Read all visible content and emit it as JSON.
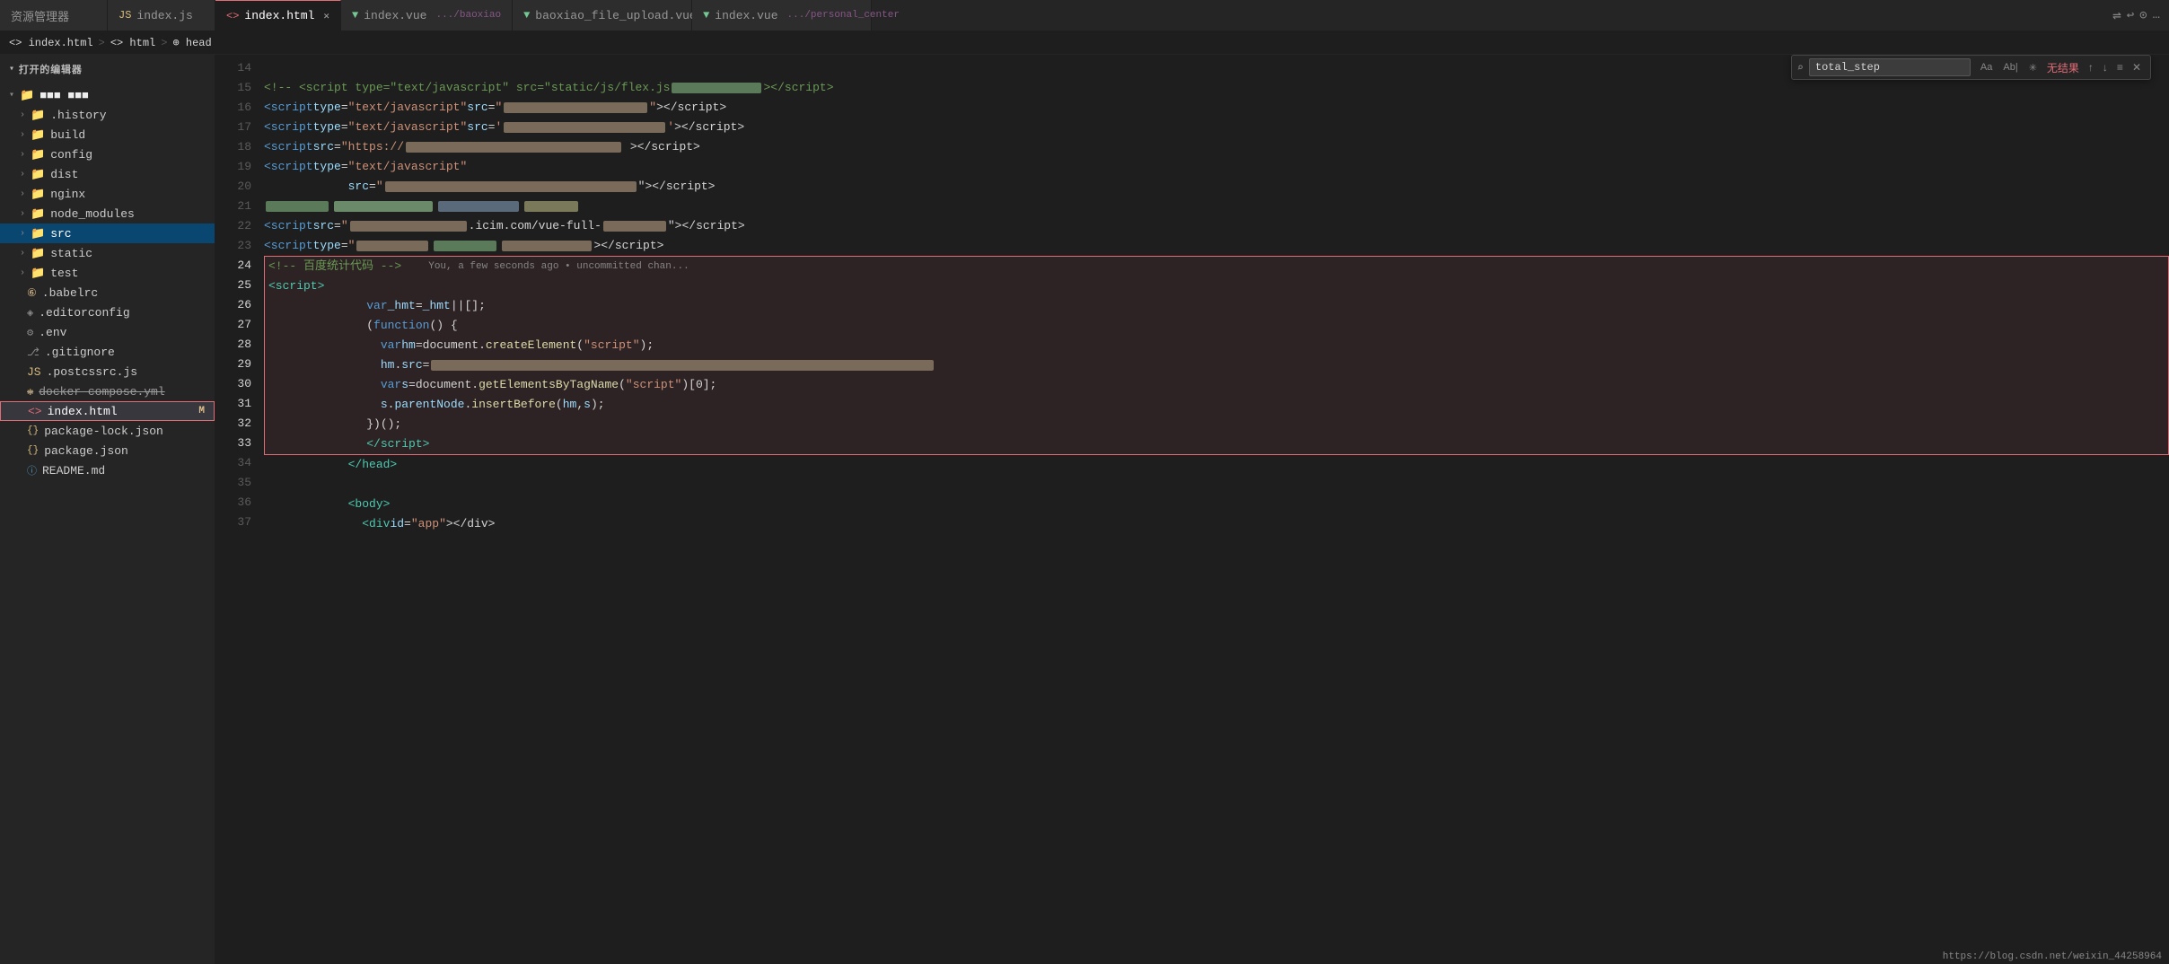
{
  "tabBar": {
    "tabs": [
      {
        "id": "resource-manager",
        "label": "资源管理器",
        "type": "resource",
        "active": false,
        "closable": false
      },
      {
        "id": "index-js",
        "label": "index.js",
        "type": "js",
        "active": false,
        "closable": false
      },
      {
        "id": "index-html",
        "label": "index.html",
        "type": "html",
        "active": true,
        "closable": true
      },
      {
        "id": "index-vue-baoxiao",
        "label": "index.vue",
        "subLabel": ".../baoxiao",
        "type": "vue",
        "active": false,
        "closable": false
      },
      {
        "id": "baoxiao-file-upload",
        "label": "baoxiao_file_upload.vue",
        "type": "vue",
        "active": false,
        "closable": false
      },
      {
        "id": "index-vue-personal",
        "label": "index.vue",
        "subLabel": ".../personal_center",
        "type": "vue",
        "active": false,
        "closable": false
      }
    ]
  },
  "breadcrumb": {
    "items": [
      "<> index.html",
      "> <> html",
      "> ⊕ head"
    ]
  },
  "sidebar": {
    "explorerTitle": "打开的编辑器",
    "projectName": "■■■ ■■■",
    "items": [
      {
        "id": "history",
        "label": ".history",
        "type": "folder",
        "indent": 1
      },
      {
        "id": "build",
        "label": "build",
        "type": "folder",
        "indent": 1
      },
      {
        "id": "config",
        "label": "config",
        "type": "folder",
        "indent": 1
      },
      {
        "id": "dist",
        "label": "dist",
        "type": "folder",
        "indent": 1
      },
      {
        "id": "nginx",
        "label": "nginx",
        "type": "folder",
        "indent": 1
      },
      {
        "id": "node_modules",
        "label": "node_modules",
        "type": "folder",
        "indent": 1
      },
      {
        "id": "src",
        "label": "src",
        "type": "folder",
        "indent": 1,
        "active": true
      },
      {
        "id": "static",
        "label": "static",
        "type": "folder",
        "indent": 1
      },
      {
        "id": "test",
        "label": "test",
        "type": "folder",
        "indent": 1
      },
      {
        "id": "babelrc",
        "label": ".babelrc",
        "type": "config",
        "indent": 1
      },
      {
        "id": "editorconfig",
        "label": ".editorconfig",
        "type": "config",
        "indent": 1
      },
      {
        "id": "env",
        "label": ".env",
        "type": "env",
        "indent": 1
      },
      {
        "id": "gitignore",
        "label": ".gitignore",
        "type": "git",
        "indent": 1
      },
      {
        "id": "postcssrc",
        "label": ".postcssrc.js",
        "type": "js",
        "indent": 1
      },
      {
        "id": "docker-compose",
        "label": "docker-compose.yml",
        "type": "yaml",
        "indent": 1,
        "strikethrough": true
      },
      {
        "id": "index-html-file",
        "label": "index.html",
        "type": "html",
        "indent": 1,
        "selected": true,
        "badge": "M"
      }
    ]
  },
  "search": {
    "placeholder": "total_step",
    "value": "total_step",
    "noResult": "无结果",
    "options": [
      "Aa",
      "Ab|",
      "✳"
    ]
  },
  "editor": {
    "filename": "index.html",
    "lines": [
      {
        "num": 14,
        "content": ""
      },
      {
        "num": 15,
        "html": "    <span class='comment'>&lt;!-- &lt;script type=\"text/javascript\" src=\"static/js/flex.js</span><span class='redacted' style='background:#5a7a5a;width:120px'></span><span class='comment'>&gt;&lt;/script&gt;</span>"
      },
      {
        "num": 16,
        "html": "    <span class='tag'>&lt;script</span> <span class='attr'>type</span><span class='punc'>=</span><span class='str'>\"text/javascript\"</span> <span class='attr'>src</span><span class='punc'>=</span><span class='str'>\"</span><span class='redacted' style='background:#7a6a5a;width:180px'></span><span class='str'>\"</span><span class='punc'>&gt;&lt;/script&gt;</span>"
      },
      {
        "num": 17,
        "html": "    <span class='tag'>&lt;script</span> <span class='attr'>type</span><span class='punc'>=</span><span class='str'>\"text/javascript\"</span> <span class='attr'>src</span><span class='punc'>=</span><span class='str'>\"</span><span class='redacted' style='background:#7a6a5a;width:200px'></span><span class='str'>\"</span><span class='punc'>&gt;&lt;/script&gt;</span>"
      },
      {
        "num": 18,
        "html": "    <span class='tag'>&lt;script</span> <span class='attr'>src</span><span class='punc'>=</span><span class='str'>\"https://</span><span class='redacted' style='background:#7a6a5a;width:260px'></span><span class='punc'>&gt;&lt;/script&gt;</span>"
      },
      {
        "num": 19,
        "html": "    <span class='tag'>&lt;script</span> <span class='attr'>type</span><span class='punc'>=</span><span class='str'>\"text/javascript\"</span>"
      },
      {
        "num": 20,
        "html": "      <span class='attr'>src</span><span class='punc'>=</span><span class='str'>\"</span><span class='redacted' style='background:#7a6a5a;width:300px'></span><span class='str'>\"</span><span class='punc'>&gt;&lt;/script&gt;</span>"
      },
      {
        "num": 21,
        "html": "    <span class='redacted' style='background:#5a7a5a;width:80px'></span><span class='redacted' style='background:#6a8a6a;width:120px;margin-left:4px'></span><span class='redacted' style='background:#5a6a7a;width:100px;margin-left:4px'></span>"
      },
      {
        "num": 22,
        "html": "    <span class='tag'>&lt;script</span> <span class='attr'>src</span><span class='punc'>=</span><span class='str'>\"</span><span class='redacted' style='background:#7a6a5a;width:160px'></span><span class='plain'>.icim.com/vue-full-</span><span class='redacted' style='background:#7a6a5a;width:80px'></span><span class='str'>\"</span><span class='punc'>&gt;&lt;/script&gt;</span>"
      },
      {
        "num": 23,
        "html": "    <span class='tag'>&lt;script</span> <span class='attr'>type</span><span class='punc'>=</span><span class='str'>\"</span><span class='redacted' style='background:#7a6a5a;width:100px'></span><span class='redacted' style='background:#5a7a5a;width:80px;margin-left:4px'></span><span class='redacted' style='background:#7a6a5a;width:120px;margin-left:4px'></span><span class='punc'>&gt;&lt;/script&gt;</span>"
      },
      {
        "num": 24,
        "html": "  <span class='comment'>&lt;!-- 百度统计代码 --&gt;</span><span style='color:#858585;margin-left:40px;font-size:11px'>You, a few seconds ago • uncommitted chan...</span>",
        "highlighted": true
      },
      {
        "num": 25,
        "html": "  <span class='tag'>&lt;script&gt;</span>",
        "highlighted": true
      },
      {
        "num": 26,
        "html": "    <span class='kw'>var</span> <span class='var'>_hmt</span> <span class='op'>=</span> <span class='var'>_hmt</span> <span class='op'>||</span> <span class='punc'>[];</span>",
        "highlighted": true
      },
      {
        "num": 27,
        "html": "    <span class='punc'>(</span><span class='kw'>function</span> <span class='punc'>() {</span>",
        "highlighted": true
      },
      {
        "num": 28,
        "html": "      <span class='kw'>var</span> <span class='var'>hm</span> <span class='op'>=</span> <span class='plain'>document</span><span class='punc'>.</span><span class='func'>createElement</span><span class='punc'>(</span><span class='str'>\"script\"</span><span class='punc'>);</span>",
        "highlighted": true
      },
      {
        "num": 29,
        "html": "      <span class='var'>hm</span><span class='punc'>.</span><span class='attr'>src</span> <span class='op'>=</span> <span class='redacted' style='background:#7a6a5a;width:600px'></span>",
        "highlighted": true
      },
      {
        "num": 30,
        "html": "      <span class='kw'>var</span> <span class='var'>s</span> <span class='op'>=</span> <span class='plain'>document</span><span class='punc'>.</span><span class='func'>getElementsByTagName</span><span class='punc'>(</span><span class='str'>\"script\"</span><span class='punc'>)[0];</span>",
        "highlighted": true
      },
      {
        "num": 31,
        "html": "      <span class='var'>s</span><span class='punc'>.</span><span class='attr'>parentNode</span><span class='punc'>.</span><span class='func'>insertBefore</span><span class='punc'>(</span><span class='var'>hm</span><span class='punc'>,</span> <span class='var'>s</span><span class='punc'>);</span>",
        "highlighted": true
      },
      {
        "num": 32,
        "html": "    <span class='punc'>})();</span>",
        "highlighted": true
      },
      {
        "num": 33,
        "html": "  <span class='tag'>&lt;/script&gt;</span>",
        "highlighted": true
      },
      {
        "num": 34,
        "html": "  <span class='tag'>&lt;/head&gt;</span>"
      },
      {
        "num": 35,
        "html": ""
      },
      {
        "num": 36,
        "html": "  <span class='tag'>&lt;body&gt;</span>"
      },
      {
        "num": 37,
        "html": "    <span class='tag'>&lt;div</span> <span class='attr'>id</span><span class='punc'>=</span><span class='str'>\"app\"</span><span class='punc'>&gt;&lt;/div&gt;</span>"
      }
    ]
  },
  "statusBar": {
    "url": "https://blog.csdn.net/weixin_44258964"
  }
}
